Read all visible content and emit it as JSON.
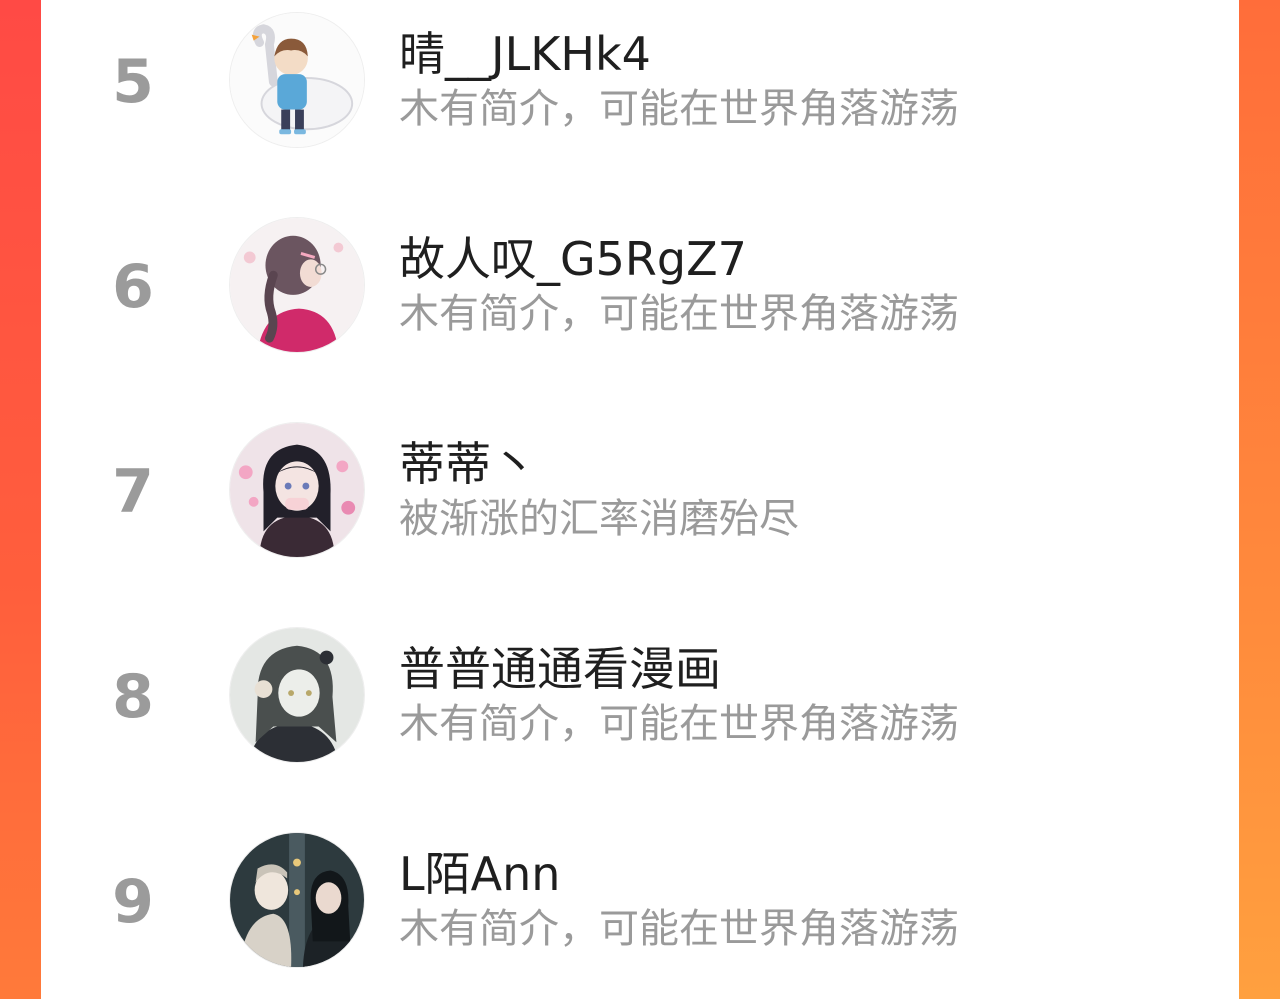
{
  "ranking": {
    "items": [
      {
        "rank": "5",
        "name": "晴__JLKHk4",
        "bio": "木有简介，可能在世界角落游荡",
        "avatar_icon": "avatar-boy-with-goose-icon"
      },
      {
        "rank": "6",
        "name": "故人叹_G5RgZ7",
        "bio": "木有简介，可能在世界角落游荡",
        "avatar_icon": "avatar-girl-braid-icon"
      },
      {
        "rank": "7",
        "name": "蒂蒂丶",
        "bio": "被渐涨的汇率消磨殆尽",
        "avatar_icon": "avatar-anime-girl-sakura-icon"
      },
      {
        "rank": "8",
        "name": "普普通通看漫画",
        "bio": "木有简介，可能在世界角落游荡",
        "avatar_icon": "avatar-anime-girl-grey-icon"
      },
      {
        "rank": "9",
        "name": "L陌Ann",
        "bio": "木有简介，可能在世界角落游荡",
        "avatar_icon": "avatar-anime-couple-icon"
      }
    ]
  },
  "colors": {
    "rank_number": "#9b9b9b",
    "name_text": "#1f1f1f",
    "bio_text": "#9a9a9a",
    "frame_left": "#ff4a45",
    "frame_right": "#ff8a3c"
  }
}
